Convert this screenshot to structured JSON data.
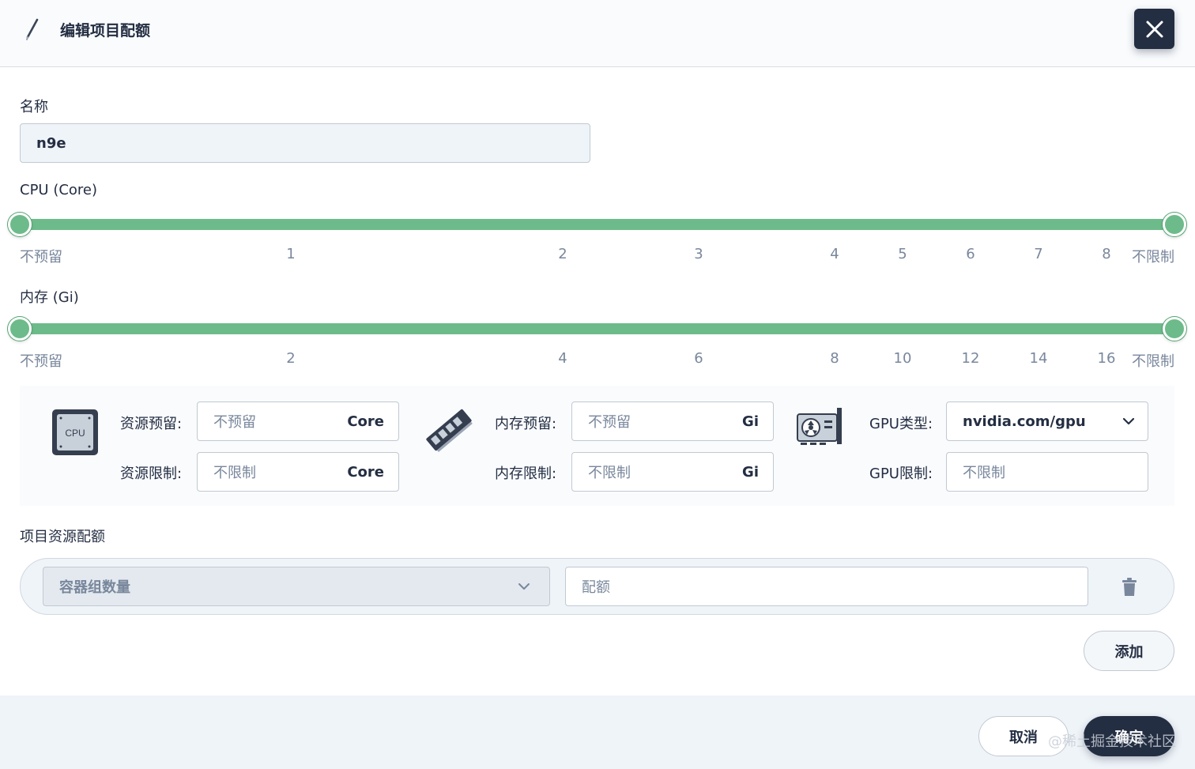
{
  "header": {
    "title": "编辑项目配额",
    "icon": "pencil-icon",
    "close_icon": "close-icon"
  },
  "name_field": {
    "label": "名称",
    "value": "n9e"
  },
  "cpu_slider": {
    "label": "CPU (Core)",
    "range": [
      "不预留",
      "不限制"
    ],
    "ticks": [
      "不预留",
      "1",
      "2",
      "3",
      "4",
      "5",
      "6",
      "7",
      "8",
      "不限制"
    ]
  },
  "memory_slider": {
    "label": "内存 (Gi)",
    "range": [
      "不预留",
      "不限制"
    ],
    "ticks": [
      "不预留",
      "2",
      "4",
      "6",
      "8",
      "10",
      "12",
      "14",
      "16",
      "不限制"
    ]
  },
  "resources": {
    "cpu": {
      "icon": "cpu-icon",
      "icon_text": "CPU",
      "request_label": "资源预留:",
      "request_placeholder": "不预留",
      "limit_label": "资源限制:",
      "limit_placeholder": "不限制",
      "unit": "Core"
    },
    "memory": {
      "icon": "memory-icon",
      "request_label": "内存预留:",
      "request_placeholder": "不预留",
      "limit_label": "内存限制:",
      "limit_placeholder": "不限制",
      "unit": "Gi"
    },
    "gpu": {
      "icon": "gpu-icon",
      "type_label": "GPU类型:",
      "type_value": "nvidia.com/gpu",
      "limit_label": "GPU限制:",
      "limit_placeholder": "不限制"
    }
  },
  "project_quota": {
    "label": "项目资源配额",
    "select_placeholder": "容器组数量",
    "quota_placeholder": "配额",
    "delete_icon": "trash-icon",
    "add_label": "添加"
  },
  "footer": {
    "cancel_label": "取消",
    "confirm_label": "确定"
  },
  "watermark": "@稀土掘金技术社区",
  "colors": {
    "accent": "#6dbb8a",
    "dark": "#242e42",
    "muted": "#79879c",
    "panel": "#f9fbfd"
  }
}
